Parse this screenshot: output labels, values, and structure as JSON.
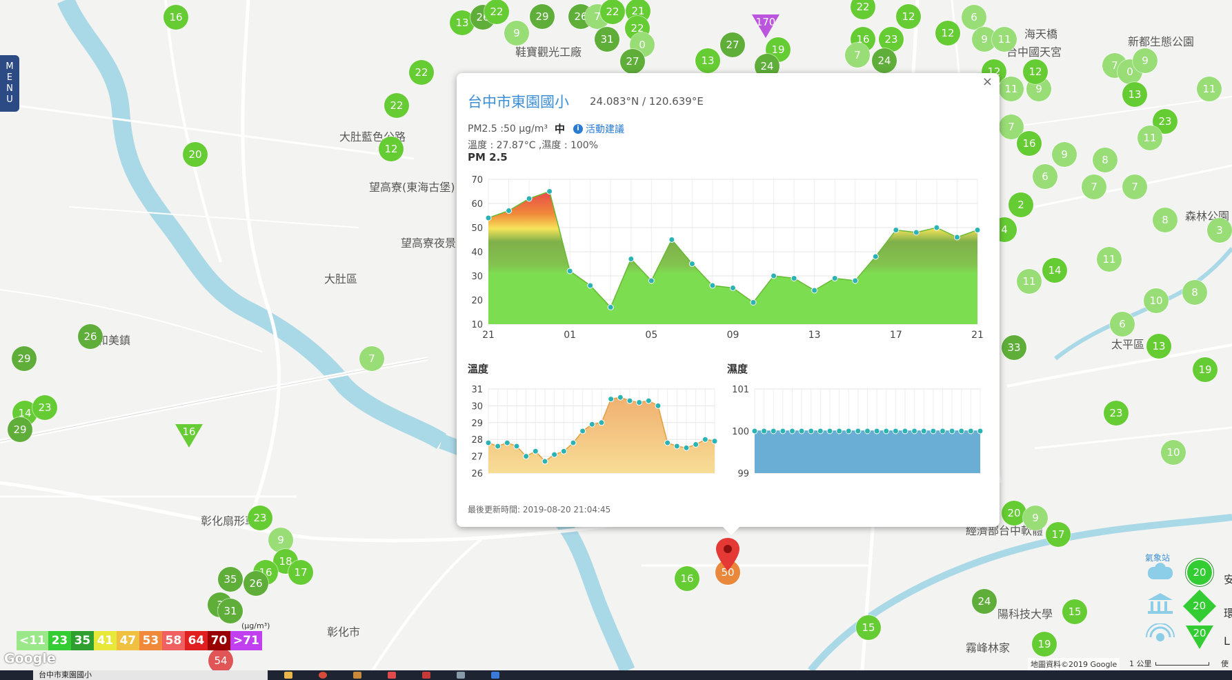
{
  "map": {
    "place_labels": [
      {
        "name": "大肚區",
        "x": 470,
        "y": 401
      },
      {
        "name": "和美鎮",
        "x": 141,
        "y": 490
      },
      {
        "name": "彰化市",
        "x": 474,
        "y": 913
      },
      {
        "name": "太平區",
        "x": 1611,
        "y": 496
      },
      {
        "name": "大肚藍色公路",
        "x": 492,
        "y": 195
      },
      {
        "name": "望高寮(東海古堡)",
        "x": 535,
        "y": 268
      },
      {
        "name": "望高寮夜景",
        "x": 581,
        "y": 349
      },
      {
        "name": "鞋寶觀光工廠",
        "x": 747,
        "y": 72
      },
      {
        "name": "台中國天宮",
        "x": 1459,
        "y": 72
      },
      {
        "name": "新都生態公園",
        "x": 1635,
        "y": 57
      },
      {
        "name": "彰化扇形車",
        "x": 291,
        "y": 752
      },
      {
        "name": "經濟部台中軟體",
        "x": 1400,
        "y": 766
      },
      {
        "name": "陽科技大學",
        "x": 1446,
        "y": 887
      },
      {
        "name": "霧峰林家",
        "x": 1400,
        "y": 936
      },
      {
        "name": "森林公園",
        "x": 1718,
        "y": 310
      },
      {
        "name": "海天橋",
        "x": 1485,
        "y": 46
      }
    ],
    "markers": [
      {
        "v": "16",
        "x": 255,
        "y": 25,
        "c": "#66cc33"
      },
      {
        "v": "13",
        "x": 670,
        "y": 33,
        "c": "#66cc33"
      },
      {
        "v": "26",
        "x": 700,
        "y": 25,
        "c": "#5fae3a"
      },
      {
        "v": "22",
        "x": 720,
        "y": 17,
        "c": "#66cc33"
      },
      {
        "v": "29",
        "x": 786,
        "y": 24,
        "c": "#5fae3a"
      },
      {
        "v": "9",
        "x": 749,
        "y": 48,
        "c": "#99dd77"
      },
      {
        "v": "26",
        "x": 842,
        "y": 24,
        "c": "#5fae3a"
      },
      {
        "v": "7",
        "x": 866,
        "y": 24,
        "c": "#99dd77"
      },
      {
        "v": "22",
        "x": 888,
        "y": 17,
        "c": "#66cc33"
      },
      {
        "v": "21",
        "x": 925,
        "y": 16,
        "c": "#66cc33"
      },
      {
        "v": "22",
        "x": 924,
        "y": 41,
        "c": "#66cc33"
      },
      {
        "v": "31",
        "x": 880,
        "y": 57,
        "c": "#5fae3a"
      },
      {
        "v": "0",
        "x": 931,
        "y": 65,
        "c": "#99dd77"
      },
      {
        "v": "27",
        "x": 917,
        "y": 89,
        "c": "#5fae3a"
      },
      {
        "v": "27",
        "x": 1062,
        "y": 65,
        "c": "#5fae3a"
      },
      {
        "v": "19",
        "x": 1128,
        "y": 72,
        "c": "#66cc33"
      },
      {
        "v": "13",
        "x": 1026,
        "y": 88,
        "c": "#66cc33"
      },
      {
        "v": "24",
        "x": 1112,
        "y": 96,
        "c": "#5fae3a"
      },
      {
        "v": "22",
        "x": 1251,
        "y": 10,
        "c": "#66cc33"
      },
      {
        "v": "12",
        "x": 1317,
        "y": 24,
        "c": "#66cc33"
      },
      {
        "v": "16",
        "x": 1251,
        "y": 57,
        "c": "#66cc33"
      },
      {
        "v": "23",
        "x": 1292,
        "y": 57,
        "c": "#66cc33"
      },
      {
        "v": "7",
        "x": 1243,
        "y": 80,
        "c": "#99dd77"
      },
      {
        "v": "24",
        "x": 1282,
        "y": 88,
        "c": "#5fae3a"
      },
      {
        "v": "12",
        "x": 1374,
        "y": 48,
        "c": "#66cc33"
      },
      {
        "v": "6",
        "x": 1412,
        "y": 25,
        "c": "#99dd77"
      },
      {
        "v": "9",
        "x": 1427,
        "y": 57,
        "c": "#99dd77"
      },
      {
        "v": "11",
        "x": 1456,
        "y": 57,
        "c": "#99dd77"
      },
      {
        "v": "12",
        "x": 1441,
        "y": 104,
        "c": "#66cc33"
      },
      {
        "v": "11",
        "x": 1466,
        "y": 129,
        "c": "#99dd77"
      },
      {
        "v": "9",
        "x": 1506,
        "y": 129,
        "c": "#99dd77"
      },
      {
        "v": "12",
        "x": 1501,
        "y": 104,
        "c": "#66cc33"
      },
      {
        "v": "7",
        "x": 1616,
        "y": 95,
        "c": "#99dd77"
      },
      {
        "v": "0",
        "x": 1638,
        "y": 104,
        "c": "#99dd77"
      },
      {
        "v": "9",
        "x": 1660,
        "y": 88,
        "c": "#99dd77"
      },
      {
        "v": "13",
        "x": 1645,
        "y": 137,
        "c": "#66cc33"
      },
      {
        "v": "11",
        "x": 1753,
        "y": 129,
        "c": "#99dd77"
      },
      {
        "v": "23",
        "x": 1689,
        "y": 176,
        "c": "#66cc33"
      },
      {
        "v": "11",
        "x": 1667,
        "y": 200,
        "c": "#99dd77"
      },
      {
        "v": "7",
        "x": 1466,
        "y": 184,
        "c": "#99dd77"
      },
      {
        "v": "16",
        "x": 1492,
        "y": 208,
        "c": "#66cc33"
      },
      {
        "v": "9",
        "x": 1543,
        "y": 224,
        "c": "#99dd77"
      },
      {
        "v": "8",
        "x": 1602,
        "y": 232,
        "c": "#99dd77"
      },
      {
        "v": "6",
        "x": 1515,
        "y": 256,
        "c": "#99dd77"
      },
      {
        "v": "7",
        "x": 1586,
        "y": 271,
        "c": "#99dd77"
      },
      {
        "v": "7",
        "x": 1645,
        "y": 271,
        "c": "#99dd77"
      },
      {
        "v": "2",
        "x": 1480,
        "y": 297,
        "c": "#66cc33"
      },
      {
        "v": "4",
        "x": 1456,
        "y": 333,
        "c": "#66cc33"
      },
      {
        "v": "8",
        "x": 1689,
        "y": 319,
        "c": "#99dd77"
      },
      {
        "v": "3",
        "x": 1768,
        "y": 334,
        "c": "#99dd77"
      },
      {
        "v": "11",
        "x": 1608,
        "y": 376,
        "c": "#99dd77"
      },
      {
        "v": "14",
        "x": 1529,
        "y": 392,
        "c": "#66cc33"
      },
      {
        "v": "11",
        "x": 1492,
        "y": 408,
        "c": "#99dd77"
      },
      {
        "v": "10",
        "x": 1676,
        "y": 436,
        "c": "#99dd77"
      },
      {
        "v": "8",
        "x": 1732,
        "y": 424,
        "c": "#99dd77"
      },
      {
        "v": "6",
        "x": 1627,
        "y": 470,
        "c": "#99dd77"
      },
      {
        "v": "13",
        "x": 1680,
        "y": 502,
        "c": "#66cc33"
      },
      {
        "v": "19",
        "x": 1747,
        "y": 536,
        "c": "#66cc33"
      },
      {
        "v": "33",
        "x": 1470,
        "y": 504,
        "c": "#5fae3a"
      },
      {
        "v": "23",
        "x": 1618,
        "y": 599,
        "c": "#66cc33"
      },
      {
        "v": "10",
        "x": 1701,
        "y": 656,
        "c": "#99dd77"
      },
      {
        "v": "20",
        "x": 1470,
        "y": 744,
        "c": "#66cc33"
      },
      {
        "v": "9",
        "x": 1501,
        "y": 751,
        "c": "#99dd77"
      },
      {
        "v": "17",
        "x": 1534,
        "y": 775,
        "c": "#66cc33"
      },
      {
        "v": "24",
        "x": 1427,
        "y": 872,
        "c": "#5fae3a"
      },
      {
        "v": "15",
        "x": 1558,
        "y": 887,
        "c": "#66cc33"
      },
      {
        "v": "19",
        "x": 1514,
        "y": 934,
        "c": "#66cc33"
      },
      {
        "v": "22",
        "x": 611,
        "y": 105,
        "c": "#66cc33"
      },
      {
        "v": "22",
        "x": 575,
        "y": 153,
        "c": "#66cc33"
      },
      {
        "v": "12",
        "x": 567,
        "y": 216,
        "c": "#66cc33"
      },
      {
        "v": "20",
        "x": 283,
        "y": 224,
        "c": "#66cc33"
      },
      {
        "v": "26",
        "x": 131,
        "y": 488,
        "c": "#5fae3a"
      },
      {
        "v": "29",
        "x": 35,
        "y": 520,
        "c": "#5fae3a"
      },
      {
        "v": "14",
        "x": 36,
        "y": 599,
        "c": "#66cc33"
      },
      {
        "v": "23",
        "x": 65,
        "y": 591,
        "c": "#66cc33"
      },
      {
        "v": "29",
        "x": 29,
        "y": 623,
        "c": "#5fae3a"
      },
      {
        "v": "7",
        "x": 539,
        "y": 520,
        "c": "#99dd77"
      },
      {
        "v": "23",
        "x": 377,
        "y": 751,
        "c": "#66cc33"
      },
      {
        "v": "9",
        "x": 407,
        "y": 783,
        "c": "#99dd77"
      },
      {
        "v": "18",
        "x": 414,
        "y": 814,
        "c": "#66cc33"
      },
      {
        "v": "17",
        "x": 436,
        "y": 830,
        "c": "#66cc33"
      },
      {
        "v": "16",
        "x": 385,
        "y": 830,
        "c": "#66cc33"
      },
      {
        "v": "35",
        "x": 334,
        "y": 840,
        "c": "#5fae3a"
      },
      {
        "v": "26",
        "x": 371,
        "y": 846,
        "c": "#5fae3a"
      },
      {
        "v": "3",
        "x": 319,
        "y": 877,
        "c": "#5fae3a"
      },
      {
        "v": "31",
        "x": 334,
        "y": 886,
        "c": "#5fae3a"
      },
      {
        "v": "16",
        "x": 996,
        "y": 839,
        "c": "#66cc33"
      },
      {
        "v": "15",
        "x": 1259,
        "y": 910,
        "c": "#66cc33"
      },
      {
        "v": "50",
        "x": 1055,
        "y": 830,
        "c": "#e9883a"
      },
      {
        "v": "54",
        "x": 320,
        "y": 958,
        "c": "#e05555"
      }
    ],
    "triangle_markers": [
      {
        "v": "170",
        "x": 1110,
        "y": 38,
        "c": "#bb55dd"
      },
      {
        "v": "16",
        "x": 274,
        "y": 632,
        "c": "#66cc33"
      }
    ],
    "side_markers": [
      {
        "v": "20",
        "shape": "circle",
        "x": 1739,
        "y": 830
      },
      {
        "v": "20",
        "shape": "diamond",
        "x": 1739,
        "y": 879
      },
      {
        "v": "20",
        "shape": "triangle",
        "x": 1739,
        "y": 924
      }
    ],
    "side_labels": [
      {
        "text": "安",
        "x": 1774,
        "y": 837
      },
      {
        "text": "環",
        "x": 1774,
        "y": 886
      },
      {
        "text": "L",
        "x": 1774,
        "y": 930
      }
    ],
    "side_icon_label": "氣象站"
  },
  "menu": {
    "label": "MENU"
  },
  "popup": {
    "close_label": "×",
    "station_name": "台中市東園國小",
    "coordinates": "24.083°N / 120.639°E",
    "pm25_text": "PM2.5 :50 μg/m³",
    "level": "中",
    "info_icon": "i",
    "advice_link": "活動建議",
    "weather_text": "溫度 : 27.87°C ,濕度 : 100%",
    "updated_text": "最後更新時間: 2019-08-20 21:04:45"
  },
  "legend": {
    "unit": "(μg/m³)",
    "items": [
      {
        "label": "<11",
        "color": "#9be88a"
      },
      {
        "label": "23",
        "color": "#33cc33"
      },
      {
        "label": "35",
        "color": "#2f9f2f"
      },
      {
        "label": "41",
        "color": "#e8e83a"
      },
      {
        "label": "47",
        "color": "#f0c040"
      },
      {
        "label": "53",
        "color": "#f08a3a"
      },
      {
        "label": "58",
        "color": "#f06060"
      },
      {
        "label": "64",
        "color": "#e02020"
      },
      {
        "label": "70",
        "color": "#990000"
      },
      {
        "label": ">71",
        "color": "#c040f0"
      }
    ]
  },
  "footer": {
    "google": "Google",
    "attribution": "地圖資料©2019 Google",
    "scale": "1 公里",
    "terms": "使用"
  },
  "taskbar": {
    "search_text": "台中市東園國小"
  },
  "chart_data": [
    {
      "type": "area",
      "title": "PM 2.5",
      "xlabel": "",
      "ylabel": "",
      "ylim": [
        10,
        70
      ],
      "yticks": [
        10,
        20,
        30,
        40,
        50,
        60,
        70
      ],
      "x_tick_labels": [
        "21",
        "01",
        "05",
        "09",
        "13",
        "17",
        "21"
      ],
      "values": [
        54,
        57,
        62,
        65,
        32,
        26,
        17,
        37,
        28,
        45,
        35,
        26,
        25,
        19,
        30,
        29,
        24,
        29,
        28,
        38,
        49,
        48,
        50,
        46,
        49
      ],
      "grid": true
    },
    {
      "type": "area",
      "title": "溫度",
      "ylim": [
        26,
        31
      ],
      "yticks": [
        26,
        27,
        28,
        29,
        30,
        31
      ],
      "values": [
        27.8,
        27.6,
        27.8,
        27.6,
        27.0,
        27.3,
        26.7,
        27.1,
        27.3,
        27.8,
        28.5,
        28.9,
        29.0,
        30.4,
        30.5,
        30.3,
        30.2,
        30.3,
        30.0,
        27.8,
        27.6,
        27.5,
        27.7,
        28.0,
        27.9
      ],
      "grid": true
    },
    {
      "type": "area",
      "title": "濕度",
      "ylim": [
        99,
        101
      ],
      "yticks": [
        99,
        100,
        101
      ],
      "values": [
        100,
        100,
        100,
        100,
        100,
        100,
        100,
        100,
        100,
        100,
        100,
        100,
        100,
        100,
        100,
        100,
        100,
        100,
        100,
        100,
        100,
        100,
        100,
        100,
        100
      ],
      "grid": true
    }
  ]
}
